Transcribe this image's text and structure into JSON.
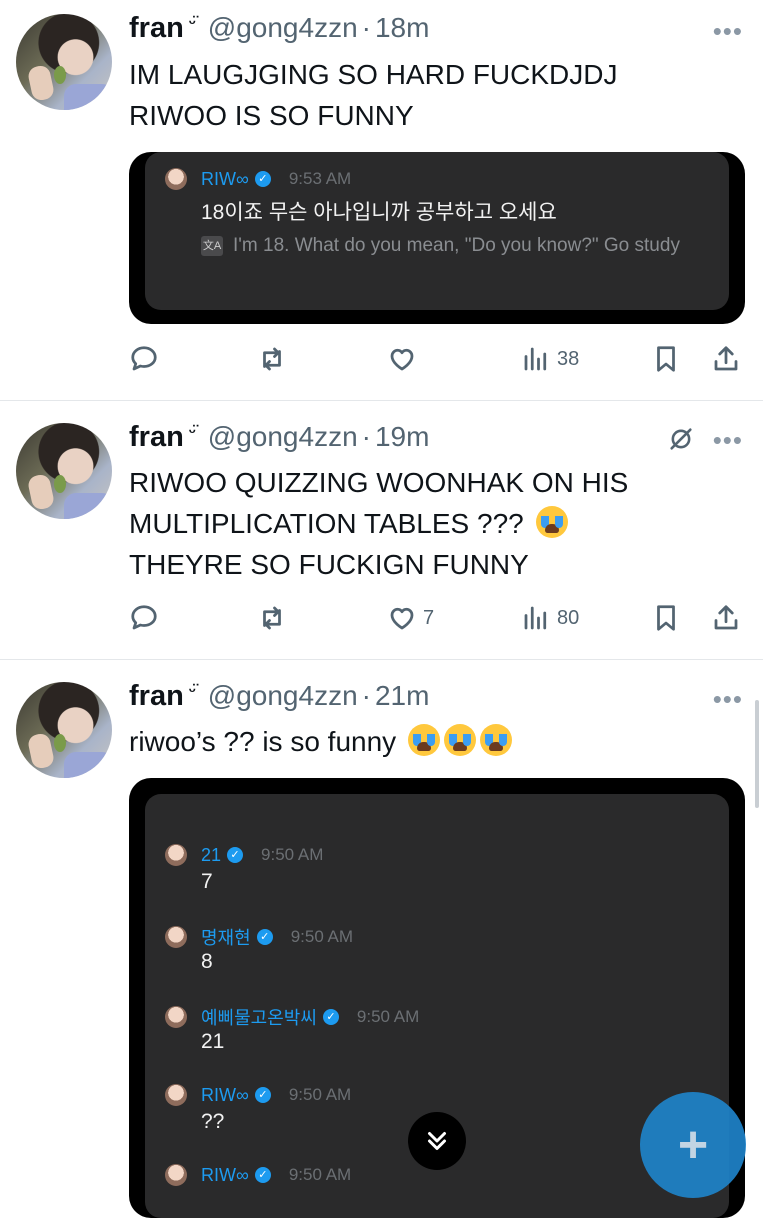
{
  "tweets": [
    {
      "name": "fran",
      "name_emoji": "ᵕ̈",
      "handle": "@gong4zzn",
      "separator": "·",
      "time": "18m",
      "more": "•••",
      "text_line1": "IM LAUGJGING SO HARD FUCKDJDJ",
      "text_line2": "RIWOO IS SO FUNNY",
      "quote": {
        "name": "RIW∞",
        "verified": "✓",
        "time": "9:53 AM",
        "message": "18이죠 무슨 아나입니까 공부하고 오세요",
        "translate_icon": "文A",
        "translation": "I'm 18. What do you mean, \"Do you know?\" Go study"
      },
      "views": "38"
    },
    {
      "name": "fran",
      "name_emoji": "ᵕ̈",
      "handle": "@gong4zzn",
      "separator": "·",
      "time": "19m",
      "more": "•••",
      "text_line1": "RIWOO QUIZZING WOONHAK ON HIS",
      "text_line2": "MULTIPLICATION TABLES ???",
      "text_line3": "THEYRE SO FUCKIGN FUNNY",
      "likes": "7",
      "views": "80"
    },
    {
      "name": "fran",
      "name_emoji": "ᵕ̈",
      "handle": "@gong4zzn",
      "separator": "·",
      "time": "21m",
      "more": "•••",
      "text": "riwoo’s ?? is so funny",
      "chat": [
        {
          "name": "21",
          "verified": "✓",
          "time": "9:50 AM",
          "message": "7"
        },
        {
          "name": "명재현",
          "verified": "✓",
          "time": "9:50 AM",
          "message": "8"
        },
        {
          "name": "예삐물고온박씨",
          "verified": "✓",
          "time": "9:50 AM",
          "message": "21"
        },
        {
          "name": "RIW∞",
          "verified": "✓",
          "time": "9:50 AM",
          "message": "??"
        },
        {
          "name": "RIW∞",
          "verified": "✓",
          "time": "9:50 AM",
          "message": ""
        }
      ]
    }
  ],
  "fab_label": "+",
  "scroll_down_label": "⌄⌄",
  "colors": {
    "accent": "#1d9bf0",
    "text": "#0f1419",
    "muted": "#536471",
    "fab": "#1f83c9"
  }
}
